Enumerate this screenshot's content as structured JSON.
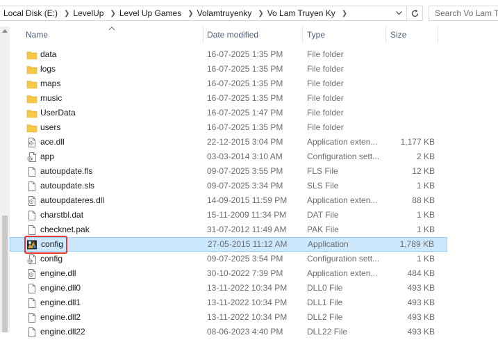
{
  "breadcrumb": {
    "items": [
      "Local Disk (E:)",
      "LevelUp",
      "Level Up Games",
      "Volamtruyenky",
      "Vo Lam Truyen Ky"
    ]
  },
  "search": {
    "placeholder": "Search Vo Lam Tr"
  },
  "columns": {
    "name": "Name",
    "date": "Date modified",
    "type": "Type",
    "size": "Size"
  },
  "colors": {
    "selection_bg": "#cce8ff",
    "selection_border": "#99d1ff",
    "highlight_box": "#e53935",
    "folder": "#f7c948"
  },
  "files": [
    {
      "name": "data",
      "date": "16-07-2025 1:35 PM",
      "type": "File folder",
      "size": "",
      "icon": "folder-icon"
    },
    {
      "name": "logs",
      "date": "16-07-2025 1:35 PM",
      "type": "File folder",
      "size": "",
      "icon": "folder-icon"
    },
    {
      "name": "maps",
      "date": "16-07-2025 1:35 PM",
      "type": "File folder",
      "size": "",
      "icon": "folder-icon"
    },
    {
      "name": "music",
      "date": "16-07-2025 1:35 PM",
      "type": "File folder",
      "size": "",
      "icon": "folder-icon"
    },
    {
      "name": "UserData",
      "date": "16-07-2025 1:47 PM",
      "type": "File folder",
      "size": "",
      "icon": "folder-icon"
    },
    {
      "name": "users",
      "date": "16-07-2025 1:35 PM",
      "type": "File folder",
      "size": "",
      "icon": "folder-icon"
    },
    {
      "name": "ace.dll",
      "date": "22-12-2015 3:04 PM",
      "type": "Application exten...",
      "size": "1,177 KB",
      "icon": "dll-file-icon"
    },
    {
      "name": "app",
      "date": "03-03-2014 3:10 AM",
      "type": "Configuration sett...",
      "size": "2 KB",
      "icon": "config-file-icon"
    },
    {
      "name": "autoupdate.fls",
      "date": "09-07-2025 3:55 PM",
      "type": "FLS File",
      "size": "12 KB",
      "icon": "file-icon"
    },
    {
      "name": "autoupdate.sls",
      "date": "09-07-2025 3:34 PM",
      "type": "SLS File",
      "size": "1 KB",
      "icon": "file-icon"
    },
    {
      "name": "autoupdateres.dll",
      "date": "14-09-2015 11:59 PM",
      "type": "Application exten...",
      "size": "88 KB",
      "icon": "dll-file-icon"
    },
    {
      "name": "charstbl.dat",
      "date": "15-11-2009 11:34 PM",
      "type": "DAT File",
      "size": "1 KB",
      "icon": "file-icon"
    },
    {
      "name": "checknet.pak",
      "date": "31-07-2012 11:49 AM",
      "type": "PAK File",
      "size": "1 KB",
      "icon": "file-icon"
    },
    {
      "name": "config",
      "date": "27-05-2015 11:12 AM",
      "type": "Application",
      "size": "1,789 KB",
      "icon": "application-icon",
      "selected": true
    },
    {
      "name": "config",
      "date": "09-07-2025 3:54 PM",
      "type": "Configuration sett...",
      "size": "1 KB",
      "icon": "config-file-icon"
    },
    {
      "name": "engine.dll",
      "date": "30-10-2022 7:39 PM",
      "type": "Application exten...",
      "size": "484 KB",
      "icon": "dll-file-icon"
    },
    {
      "name": "engine.dll0",
      "date": "13-11-2022 10:34 PM",
      "type": "DLL0 File",
      "size": "493 KB",
      "icon": "file-icon"
    },
    {
      "name": "engine.dll1",
      "date": "13-11-2022 10:34 PM",
      "type": "DLL1 File",
      "size": "493 KB",
      "icon": "file-icon"
    },
    {
      "name": "engine.dll2",
      "date": "13-11-2022 10:34 PM",
      "type": "DLL2 File",
      "size": "493 KB",
      "icon": "file-icon"
    },
    {
      "name": "engine.dll22",
      "date": "08-06-2023 4:40 PM",
      "type": "DLL22 File",
      "size": "493 KB",
      "icon": "file-icon"
    }
  ]
}
